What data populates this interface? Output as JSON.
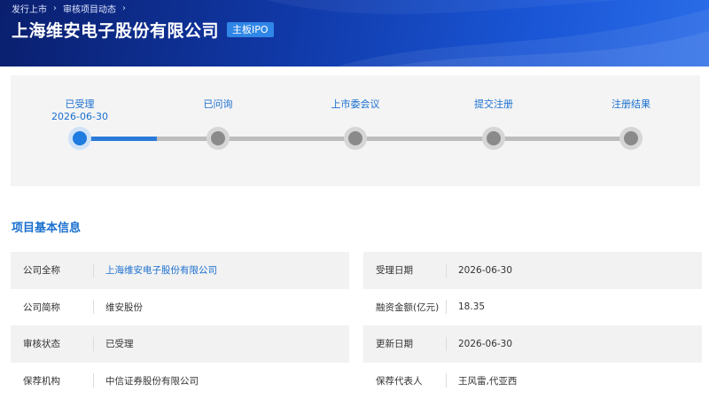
{
  "breadcrumb": [
    {
      "label": "发行上市"
    },
    {
      "label": "审核项目动态"
    }
  ],
  "company": {
    "name": "上海维安电子股份有限公司",
    "board_badge": "主板IPO"
  },
  "steps": [
    {
      "label": "已受理",
      "date": "2026-06-30",
      "active": true
    },
    {
      "label": "已问询",
      "date": "",
      "active": false
    },
    {
      "label": "上市委会议",
      "date": "",
      "active": false
    },
    {
      "label": "提交注册",
      "date": "",
      "active": false
    },
    {
      "label": "注册结果",
      "date": "",
      "active": false
    }
  ],
  "progress_fraction": 0.14,
  "section_title": "项目基本信息",
  "info": {
    "left": [
      {
        "label": "公司全称",
        "value": "上海维安电子股份有限公司",
        "link": true
      },
      {
        "label": "公司简称",
        "value": "维安股份"
      },
      {
        "label": "审核状态",
        "value": "已受理"
      },
      {
        "label": "保荐机构",
        "value": "中信证券股份有限公司"
      }
    ],
    "right": [
      {
        "label": "受理日期",
        "value": "2026-06-30"
      },
      {
        "label": "融资金额(亿元)",
        "value": "18.35"
      },
      {
        "label": "更新日期",
        "value": "2026-06-30"
      },
      {
        "label": "保荐代表人",
        "value": "王风雷,代亚西"
      }
    ]
  },
  "colors": {
    "accent": "#1a6fd0",
    "badge": "#2f86e6",
    "active_node": "#1e7be0",
    "inactive_node": "#8a8a8a"
  }
}
